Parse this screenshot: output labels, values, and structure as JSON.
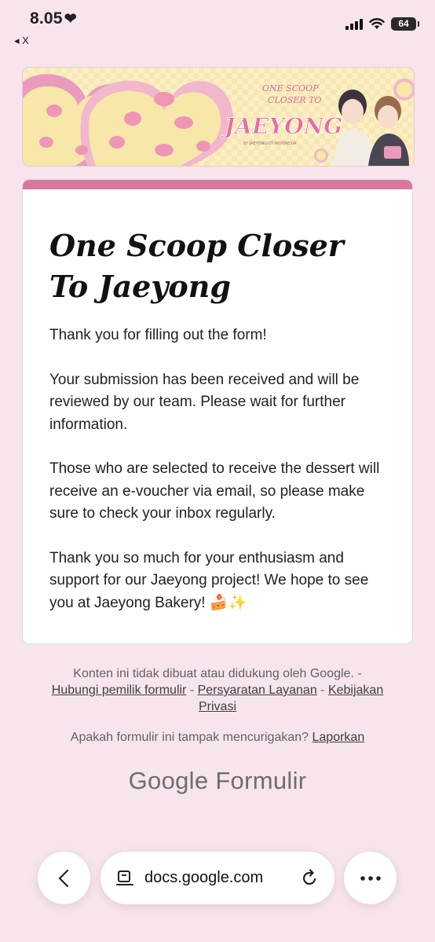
{
  "status_bar": {
    "time": "8.05",
    "heart": "❤",
    "back_app": "◂ X",
    "battery": "64"
  },
  "banner": {
    "title_line1": "ONE SCOOP",
    "title_line2": "CLOSER TO",
    "title_main": "JAEYONG",
    "byline": "BY JAEYONGIST INDONESIA",
    "colors": {
      "background": "#fbf0c4",
      "pink": "#e99bbb",
      "cookie": "#f7e7a9"
    }
  },
  "card": {
    "accent_color": "#d9779c",
    "title": "One Scoop Closer To Jaeyong",
    "paragraphs": [
      "Thank you for filling out the form!",
      "Your submission has been received and will be reviewed by our team. Please wait for further information.",
      "Those who are selected to receive the dessert will receive an e-voucher via email, so please make sure to check your inbox regularly.",
      "Thank you so much for your enthusiasm and support for our Jaeyong project! We hope to see you at Jaeyong Bakery! 🍰✨"
    ]
  },
  "footer": {
    "disclaimer": "Konten ini tidak dibuat atau didukung oleh Google.",
    "sep1": " - ",
    "link_contact": "Hubungi pemilik formulir",
    "sep2": " - ",
    "link_terms": "Persyaratan Layanan",
    "sep3": " - ",
    "link_privacy": "Kebijakan Privasi",
    "suspicious_text": "Apakah formulir ini tampak mencurigakan?",
    "link_report": "Laporkan",
    "logo_google": "Google",
    "logo_forms": "Formulir"
  },
  "browser": {
    "url": "docs.google.com",
    "icons": [
      "back-icon",
      "reader-mode-icon",
      "reload-icon",
      "more-icon"
    ]
  }
}
